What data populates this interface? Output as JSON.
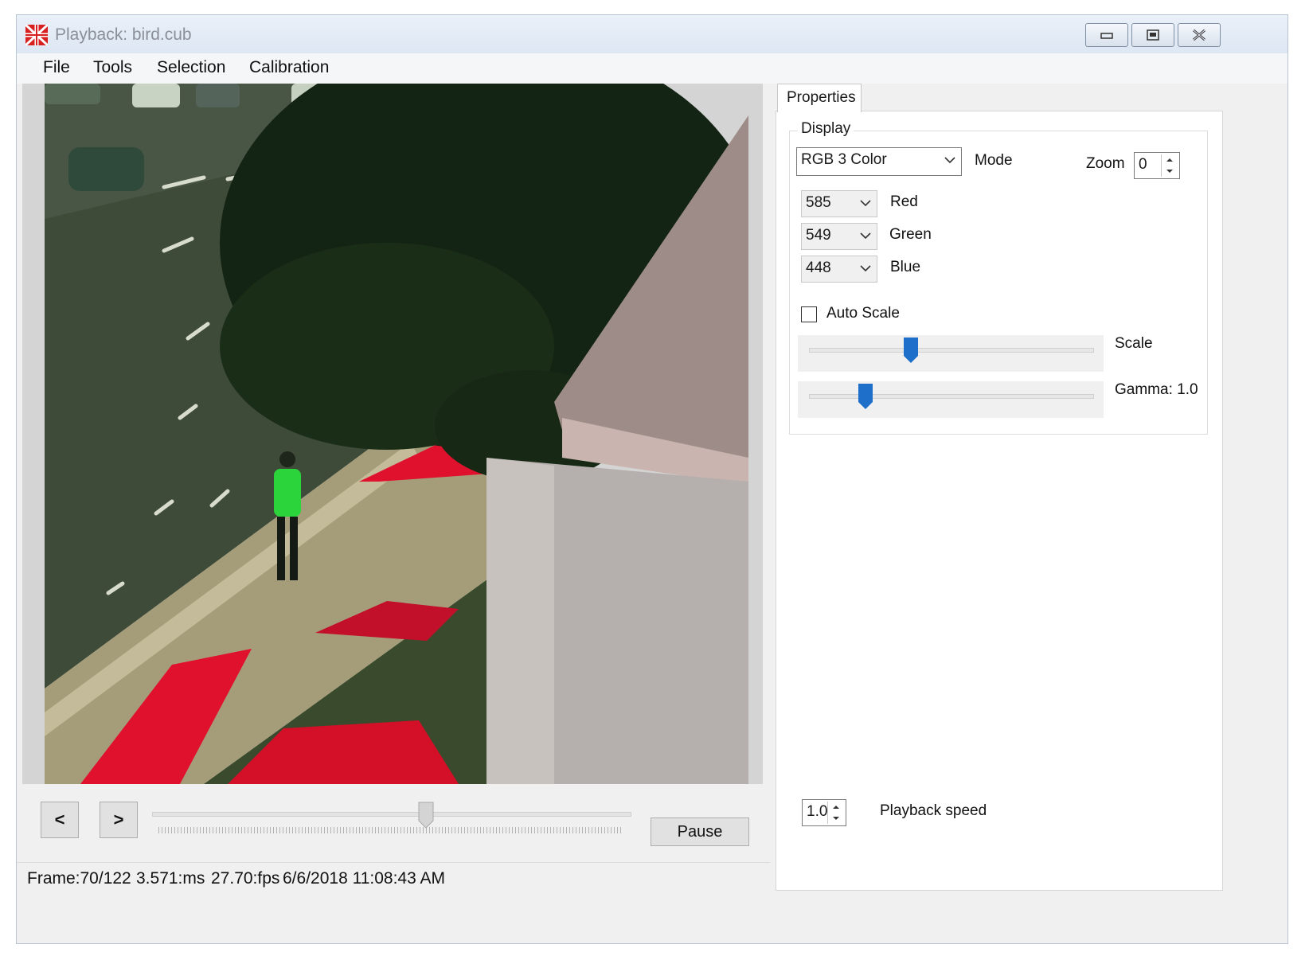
{
  "window": {
    "title": "Playback: bird.cub",
    "icon": "app-flag-icon",
    "controls": [
      "minimize-icon",
      "maximize-icon",
      "close-icon"
    ]
  },
  "menu": {
    "items": [
      {
        "label": "File"
      },
      {
        "label": "Tools"
      },
      {
        "label": "Selection"
      },
      {
        "label": "Calibration"
      }
    ]
  },
  "playback": {
    "prev_label": "<",
    "next_label": ">",
    "pause_label": "Pause",
    "frame_current": 70,
    "frame_total": 122
  },
  "status": {
    "frame": "Frame:70/122",
    "exposure": "3.571:ms",
    "fps": "27.70:fps",
    "timestamp": "6/6/2018 11:08:43 AM"
  },
  "properties": {
    "tab_label": "Properties",
    "display": {
      "legend": "Display",
      "mode_value": "RGB 3 Color",
      "mode_label": "Mode",
      "zoom_label": "Zoom",
      "zoom_value": "0",
      "red_value": "585",
      "red_label": "Red",
      "green_value": "549",
      "green_label": "Green",
      "blue_value": "448",
      "blue_label": "Blue",
      "auto_scale_label": "Auto Scale",
      "auto_scale_checked": false,
      "scale_label": "Scale",
      "scale_level": 0.36,
      "gamma_label": "Gamma: 1.0",
      "gamma_level": 0.2
    },
    "playback_speed_value": "1.0",
    "playback_speed_label": "Playback speed"
  },
  "colors": {
    "accent_thumb": "#1e6fc9",
    "highlight_red": "#e0112c",
    "highlight_green": "#2bd43a"
  }
}
